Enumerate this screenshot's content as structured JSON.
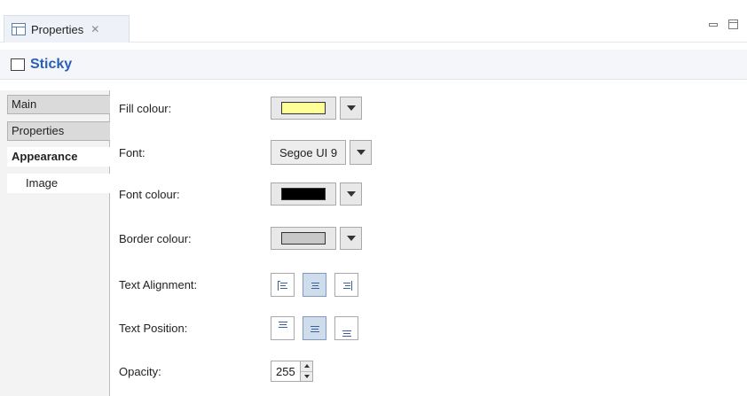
{
  "view_tab": {
    "title": "Properties",
    "close_symbol": "✕"
  },
  "window_controls": [
    "minimize-icon",
    "maximize-icon"
  ],
  "header": {
    "title": "Sticky"
  },
  "tabs": [
    {
      "label": "Main",
      "state": "normal"
    },
    {
      "label": "Properties",
      "state": "normal"
    },
    {
      "label": "Appearance",
      "state": "active"
    },
    {
      "label": "Image",
      "state": "sub"
    }
  ],
  "fields": {
    "fill_colour": {
      "label": "Fill colour:",
      "color": "#ffff99"
    },
    "font": {
      "label": "Font:",
      "value": "Segoe UI 9"
    },
    "font_colour": {
      "label": "Font colour:",
      "color": "#000000"
    },
    "border_colour": {
      "label": "Border colour:",
      "color": "#c8c8c8"
    },
    "text_alignment": {
      "label": "Text Alignment:",
      "options": [
        "left",
        "center",
        "right"
      ],
      "selected": "center"
    },
    "text_position": {
      "label": "Text Position:",
      "options": [
        "top",
        "middle",
        "bottom"
      ],
      "selected": "middle"
    },
    "opacity": {
      "label": "Opacity:",
      "value": "255"
    }
  },
  "colors": {
    "accent_title": "#2a5fb5",
    "selected_button": "#cfdcec"
  }
}
